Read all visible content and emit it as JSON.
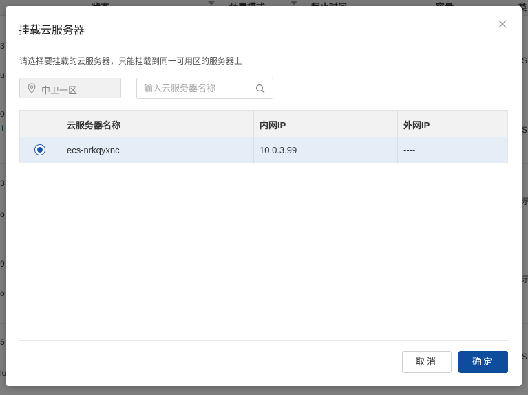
{
  "background": {
    "headers": {
      "status": "状态",
      "billing": "计费模式",
      "start_time": "起止时间",
      "capacity": "容量",
      "type": "类"
    },
    "fragments": [
      "3",
      "u",
      "0",
      "1",
      "S",
      "3",
      "o",
      "ñ",
      "9",
      "|",
      "o",
      "5",
      "lu",
      "S",
      "示",
      "示",
      "S"
    ]
  },
  "dialog": {
    "title": "挂载云服务器",
    "description": "请选择要挂载的云服务器，只能挂载到同一可用区的服务器上",
    "zone_value": "中卫一区",
    "search_placeholder": "输入云服务器名称",
    "table": {
      "headers": [
        "",
        "云服务器名称",
        "内网IP",
        "外网IP"
      ],
      "rows": [
        {
          "selected": true,
          "name": "ecs-nrkqyxnc",
          "private_ip": "10.0.3.99",
          "public_ip": "----"
        }
      ]
    },
    "buttons": {
      "cancel": "取消",
      "confirm": "确定"
    }
  },
  "colors": {
    "primary": "#0e4c9c",
    "selected_row": "#e5edf7",
    "overlay": "rgba(0,0,0,0.5)"
  },
  "icons": {
    "close": "close-icon",
    "location": "location-pin-icon",
    "search": "search-icon"
  }
}
